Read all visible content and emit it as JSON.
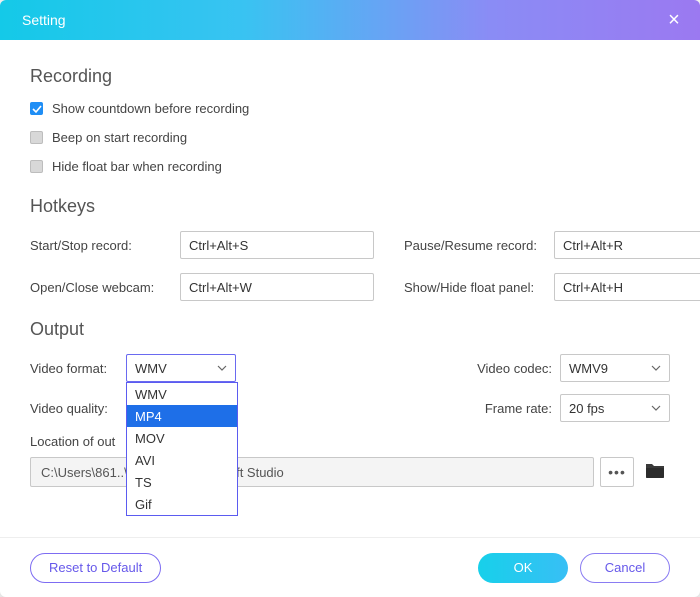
{
  "window": {
    "title": "Setting"
  },
  "recording": {
    "header": "Recording",
    "options": [
      {
        "label": "Show countdown before recording",
        "checked": true
      },
      {
        "label": "Beep on start recording",
        "checked": false
      },
      {
        "label": "Hide float bar when recording",
        "checked": false
      }
    ]
  },
  "hotkeys": {
    "header": "Hotkeys",
    "items": {
      "start_stop": {
        "label": "Start/Stop record:",
        "value": "Ctrl+Alt+S"
      },
      "pause_resume": {
        "label": "Pause/Resume record:",
        "value": "Ctrl+Alt+R"
      },
      "open_close_webcam": {
        "label": "Open/Close webcam:",
        "value": "Ctrl+Alt+W"
      },
      "show_hide_float": {
        "label": "Show/Hide float panel:",
        "value": "Ctrl+Alt+H"
      }
    }
  },
  "output": {
    "header": "Output",
    "video_format": {
      "label": "Video format:",
      "value": "WMV",
      "options": [
        "WMV",
        "MP4",
        "MOV",
        "AVI",
        "TS",
        "Gif"
      ],
      "highlight_index": 1
    },
    "video_codec": {
      "label": "Video codec:",
      "value": "WMV9"
    },
    "video_quality": {
      "label": "Video quality:",
      "value": ""
    },
    "frame_rate": {
      "label": "Frame rate:",
      "value": "20 fps"
    },
    "location": {
      "label": "Location of out",
      "path": "C:\\Users\\861..\\Documents\\...desoft Studio",
      "ellipsis": "•••"
    }
  },
  "footer": {
    "reset": "Reset to Default",
    "ok": "OK",
    "cancel": "Cancel"
  }
}
